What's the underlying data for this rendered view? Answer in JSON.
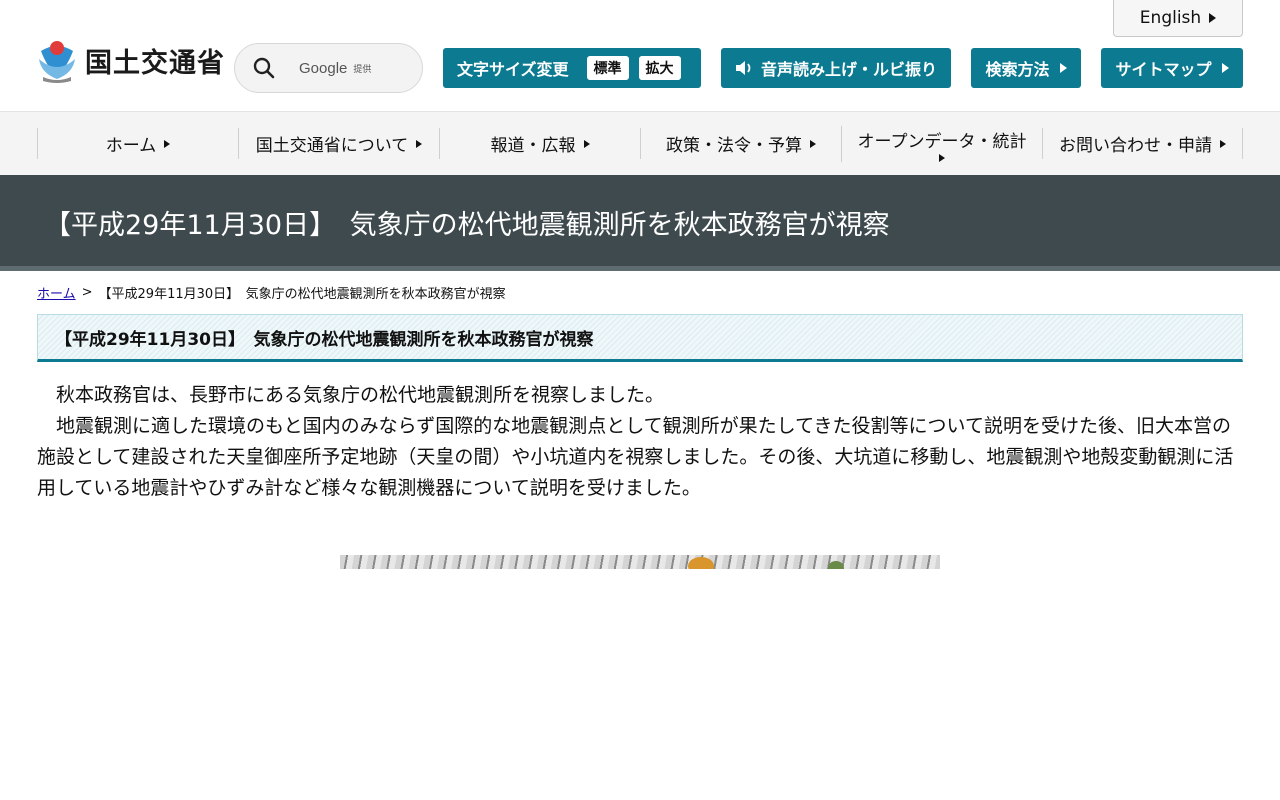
{
  "header": {
    "language_label": "English",
    "logo_text": "国土交通省",
    "search_brand": "Google",
    "search_brand_sub": "提供",
    "font_size": {
      "label": "文字サイズ変更",
      "standard": "標準",
      "large": "拡大"
    },
    "voice_label": "音声読み上げ・ルビ振り",
    "search_method_label": "検索方法",
    "sitemap_label": "サイトマップ"
  },
  "nav": {
    "items": [
      {
        "label": "ホーム"
      },
      {
        "label": "国土交通省について"
      },
      {
        "label": "報道・広報"
      },
      {
        "label": "政策・法令・予算"
      },
      {
        "label": "オープンデータ・統計"
      },
      {
        "label": "お問い合わせ・申請"
      }
    ]
  },
  "page": {
    "title": "【平成29年11月30日】　気象庁の松代地震観測所を秋本政務官が視察",
    "breadcrumb": {
      "home": "ホーム",
      "separator": ">",
      "current": "【平成29年11月30日】　気象庁の松代地震観測所を秋本政務官が視察"
    },
    "section_heading": "【平成29年11月30日】　気象庁の松代地震観測所を秋本政務官が視察",
    "paragraphs": [
      "秋本政務官は、長野市にある気象庁の松代地震観測所を視察しました。",
      "地震観測に適した環境のもと国内のみならず国際的な地震観測点として観測所が果たしてきた役割等について説明を受けた後、旧大本営の施設として建設された天皇御座所予定地跡（天皇の間）や小坑道内を視察しました。その後、大坑道に移動し、地震観測や地殻変動観測に活用している地震計やひずみ計など様々な観測機器について説明を受けました。"
    ]
  },
  "colors": {
    "accent": "#0c7b91",
    "banner": "#3e4a4e",
    "nav_bg": "#f4f4f4"
  }
}
